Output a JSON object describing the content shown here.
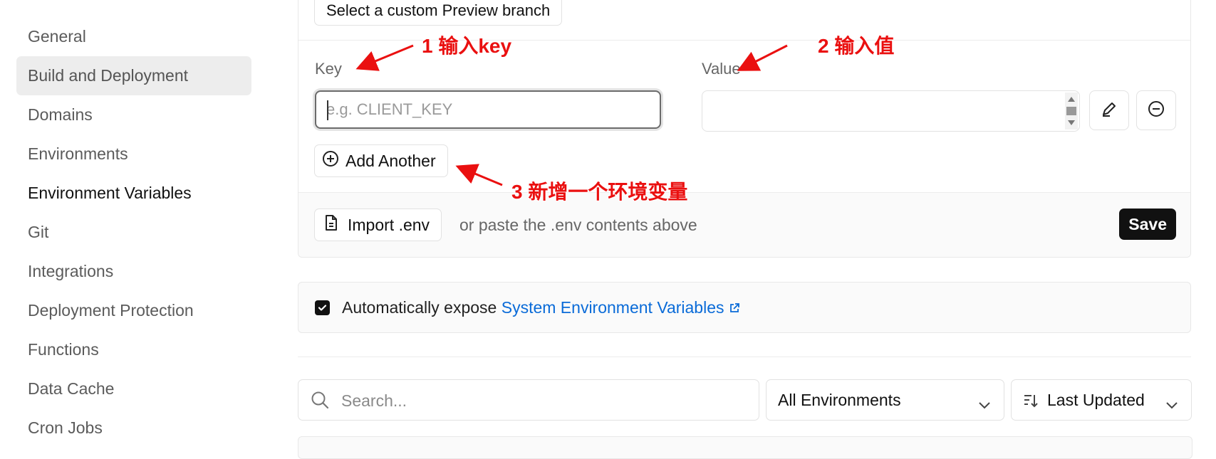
{
  "sidebar": {
    "items": [
      {
        "label": "General"
      },
      {
        "label": "Build and Deployment"
      },
      {
        "label": "Domains"
      },
      {
        "label": "Environments"
      },
      {
        "label": "Environment Variables"
      },
      {
        "label": "Git"
      },
      {
        "label": "Integrations"
      },
      {
        "label": "Deployment Protection"
      },
      {
        "label": "Functions"
      },
      {
        "label": "Data Cache"
      },
      {
        "label": "Cron Jobs"
      }
    ],
    "hovered": "Build and Deployment",
    "current": "Environment Variables"
  },
  "env_form": {
    "branch_button": "Select a custom Preview branch",
    "key_label": "Key",
    "value_label": "Value",
    "key_placeholder": "e.g. CLIENT_KEY",
    "key_value": "",
    "value_value": "",
    "edit_icon": "pencil-icon",
    "remove_icon": "minus-circle-icon",
    "add_another": "Add Another",
    "import_env": "Import .env",
    "paste_hint": "or paste the .env contents above",
    "save": "Save"
  },
  "auto_expose": {
    "checked": true,
    "text": "Automatically expose",
    "link": "System Environment Variables"
  },
  "filters": {
    "search_placeholder": "Search...",
    "environment_select": "All Environments",
    "sort_select": "Last Updated"
  },
  "annotations": {
    "a1": "1 输入key",
    "a2": "2 输入值",
    "a3": "3 新增一个环境变量"
  },
  "colors": {
    "annotation": "#ea1010",
    "link": "#0a6bd8",
    "primary_button": "#111111"
  }
}
